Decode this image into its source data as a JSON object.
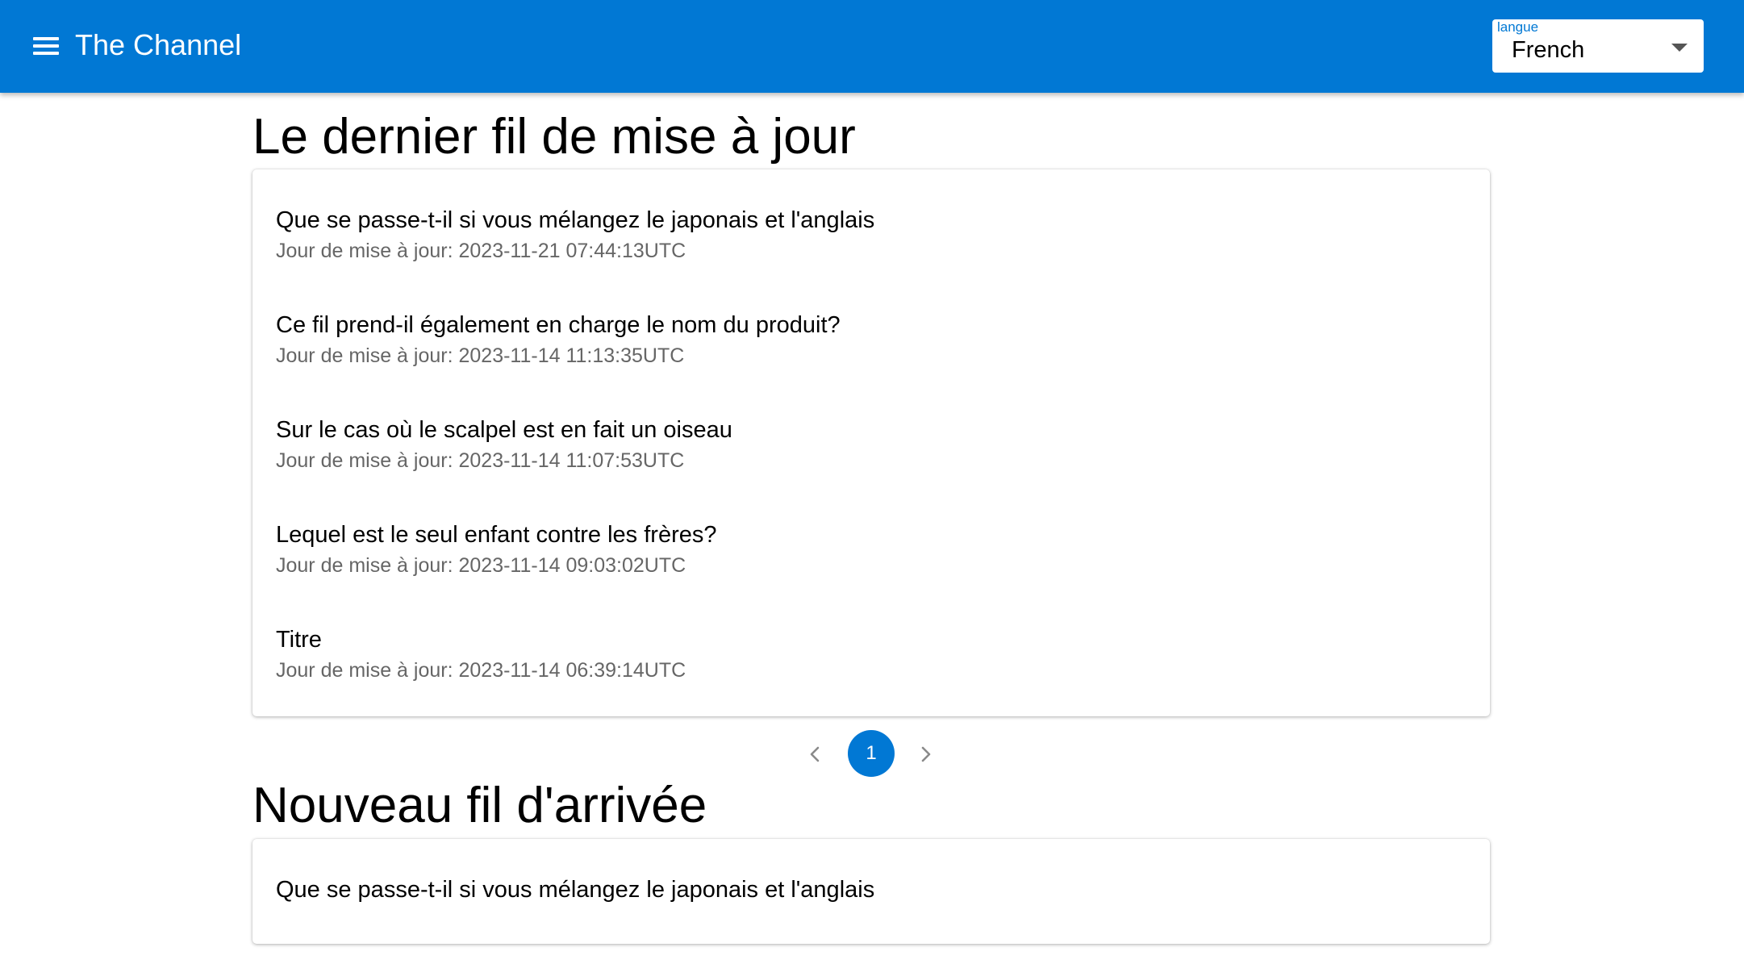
{
  "appbar": {
    "title": "The Channel",
    "language_label": "langue",
    "language_value": "French"
  },
  "updated_section": {
    "title": "Le dernier fil de mise à jour",
    "threads": [
      {
        "title": "Que se passe-t-il si vous mélangez le japonais et l'anglais",
        "date": "Jour de mise à jour: 2023-11-21 07:44:13UTC"
      },
      {
        "title": "Ce fil prend-il également en charge le nom du produit?",
        "date": "Jour de mise à jour: 2023-11-14 11:13:35UTC"
      },
      {
        "title": "Sur le cas où le scalpel est en fait un oiseau",
        "date": "Jour de mise à jour: 2023-11-14 11:07:53UTC"
      },
      {
        "title": "Lequel est le seul enfant contre les frères?",
        "date": "Jour de mise à jour: 2023-11-14 09:03:02UTC"
      },
      {
        "title": "Titre",
        "date": "Jour de mise à jour: 2023-11-14 06:39:14UTC"
      }
    ]
  },
  "pagination": {
    "current_page": "1"
  },
  "new_section": {
    "title": "Nouveau fil d'arrivée",
    "threads": [
      {
        "title": "Que se passe-t-il si vous mélangez le japonais et l'anglais"
      }
    ]
  },
  "colors": {
    "primary": "#0178d4",
    "secondary_text": "#666666"
  },
  "icons": {
    "menu": "menu-icon",
    "dropdown": "caret-down-icon",
    "prev": "chevron-left-icon",
    "next": "chevron-right-icon"
  }
}
